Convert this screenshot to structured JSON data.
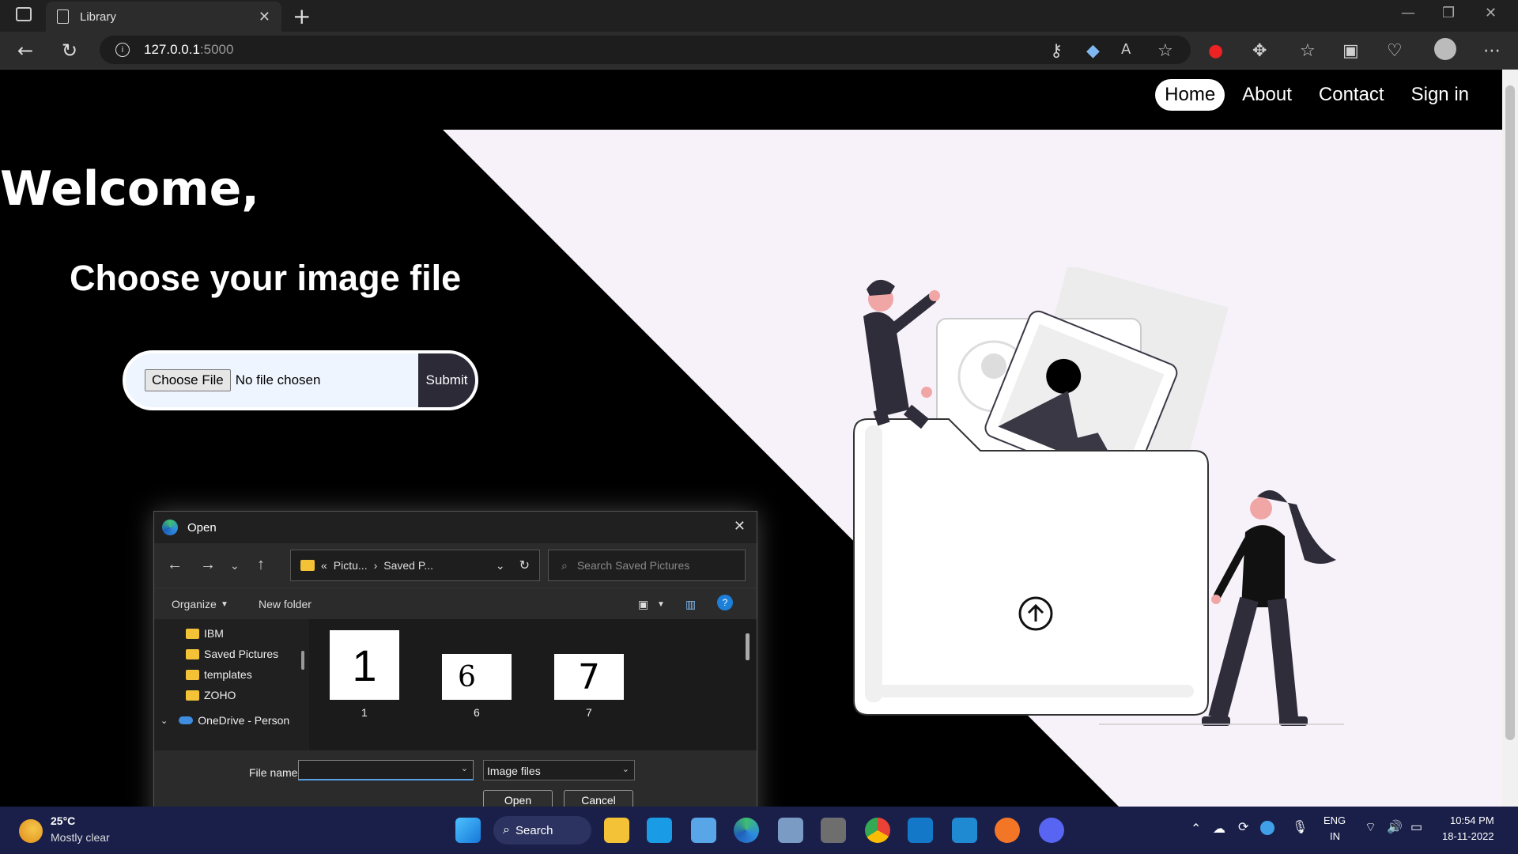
{
  "browser": {
    "tab_title": "Library",
    "url_host": "127.0.0.1",
    "url_port": ":5000"
  },
  "page": {
    "nav": [
      "Home",
      "About",
      "Contact",
      "Sign in"
    ],
    "welcome": "Welcome,",
    "heading": "Choose your image file",
    "choose_file": "Choose File",
    "no_file": "No file chosen",
    "submit": "Submit"
  },
  "dialog": {
    "title": "Open",
    "path_parent": "Pictu...",
    "path_current": "Saved P...",
    "search_placeholder": "Search Saved Pictures",
    "organize": "Organize",
    "new_folder": "New folder",
    "sidebar": [
      "IBM",
      "Saved Pictures",
      "templates",
      "ZOHO",
      "OneDrive - Person"
    ],
    "files": [
      {
        "name": "1",
        "glyph": "1"
      },
      {
        "name": "6",
        "glyph": "6"
      },
      {
        "name": "7",
        "glyph": "7"
      }
    ],
    "file_name_label": "File name:",
    "file_name_value": "",
    "file_type": "Image files",
    "open_btn": "Open",
    "cancel_btn": "Cancel"
  },
  "taskbar": {
    "temp": "25°C",
    "weather": "Mostly clear",
    "search": "Search",
    "lang1": "ENG",
    "lang2": "IN",
    "time": "10:54 PM",
    "date": "18-11-2022"
  },
  "colors": {
    "page_dark": "#000000",
    "page_light": "#f7f2f9",
    "submit_bg": "#2d2a38",
    "taskbar_bg": "#1a1f4a"
  }
}
